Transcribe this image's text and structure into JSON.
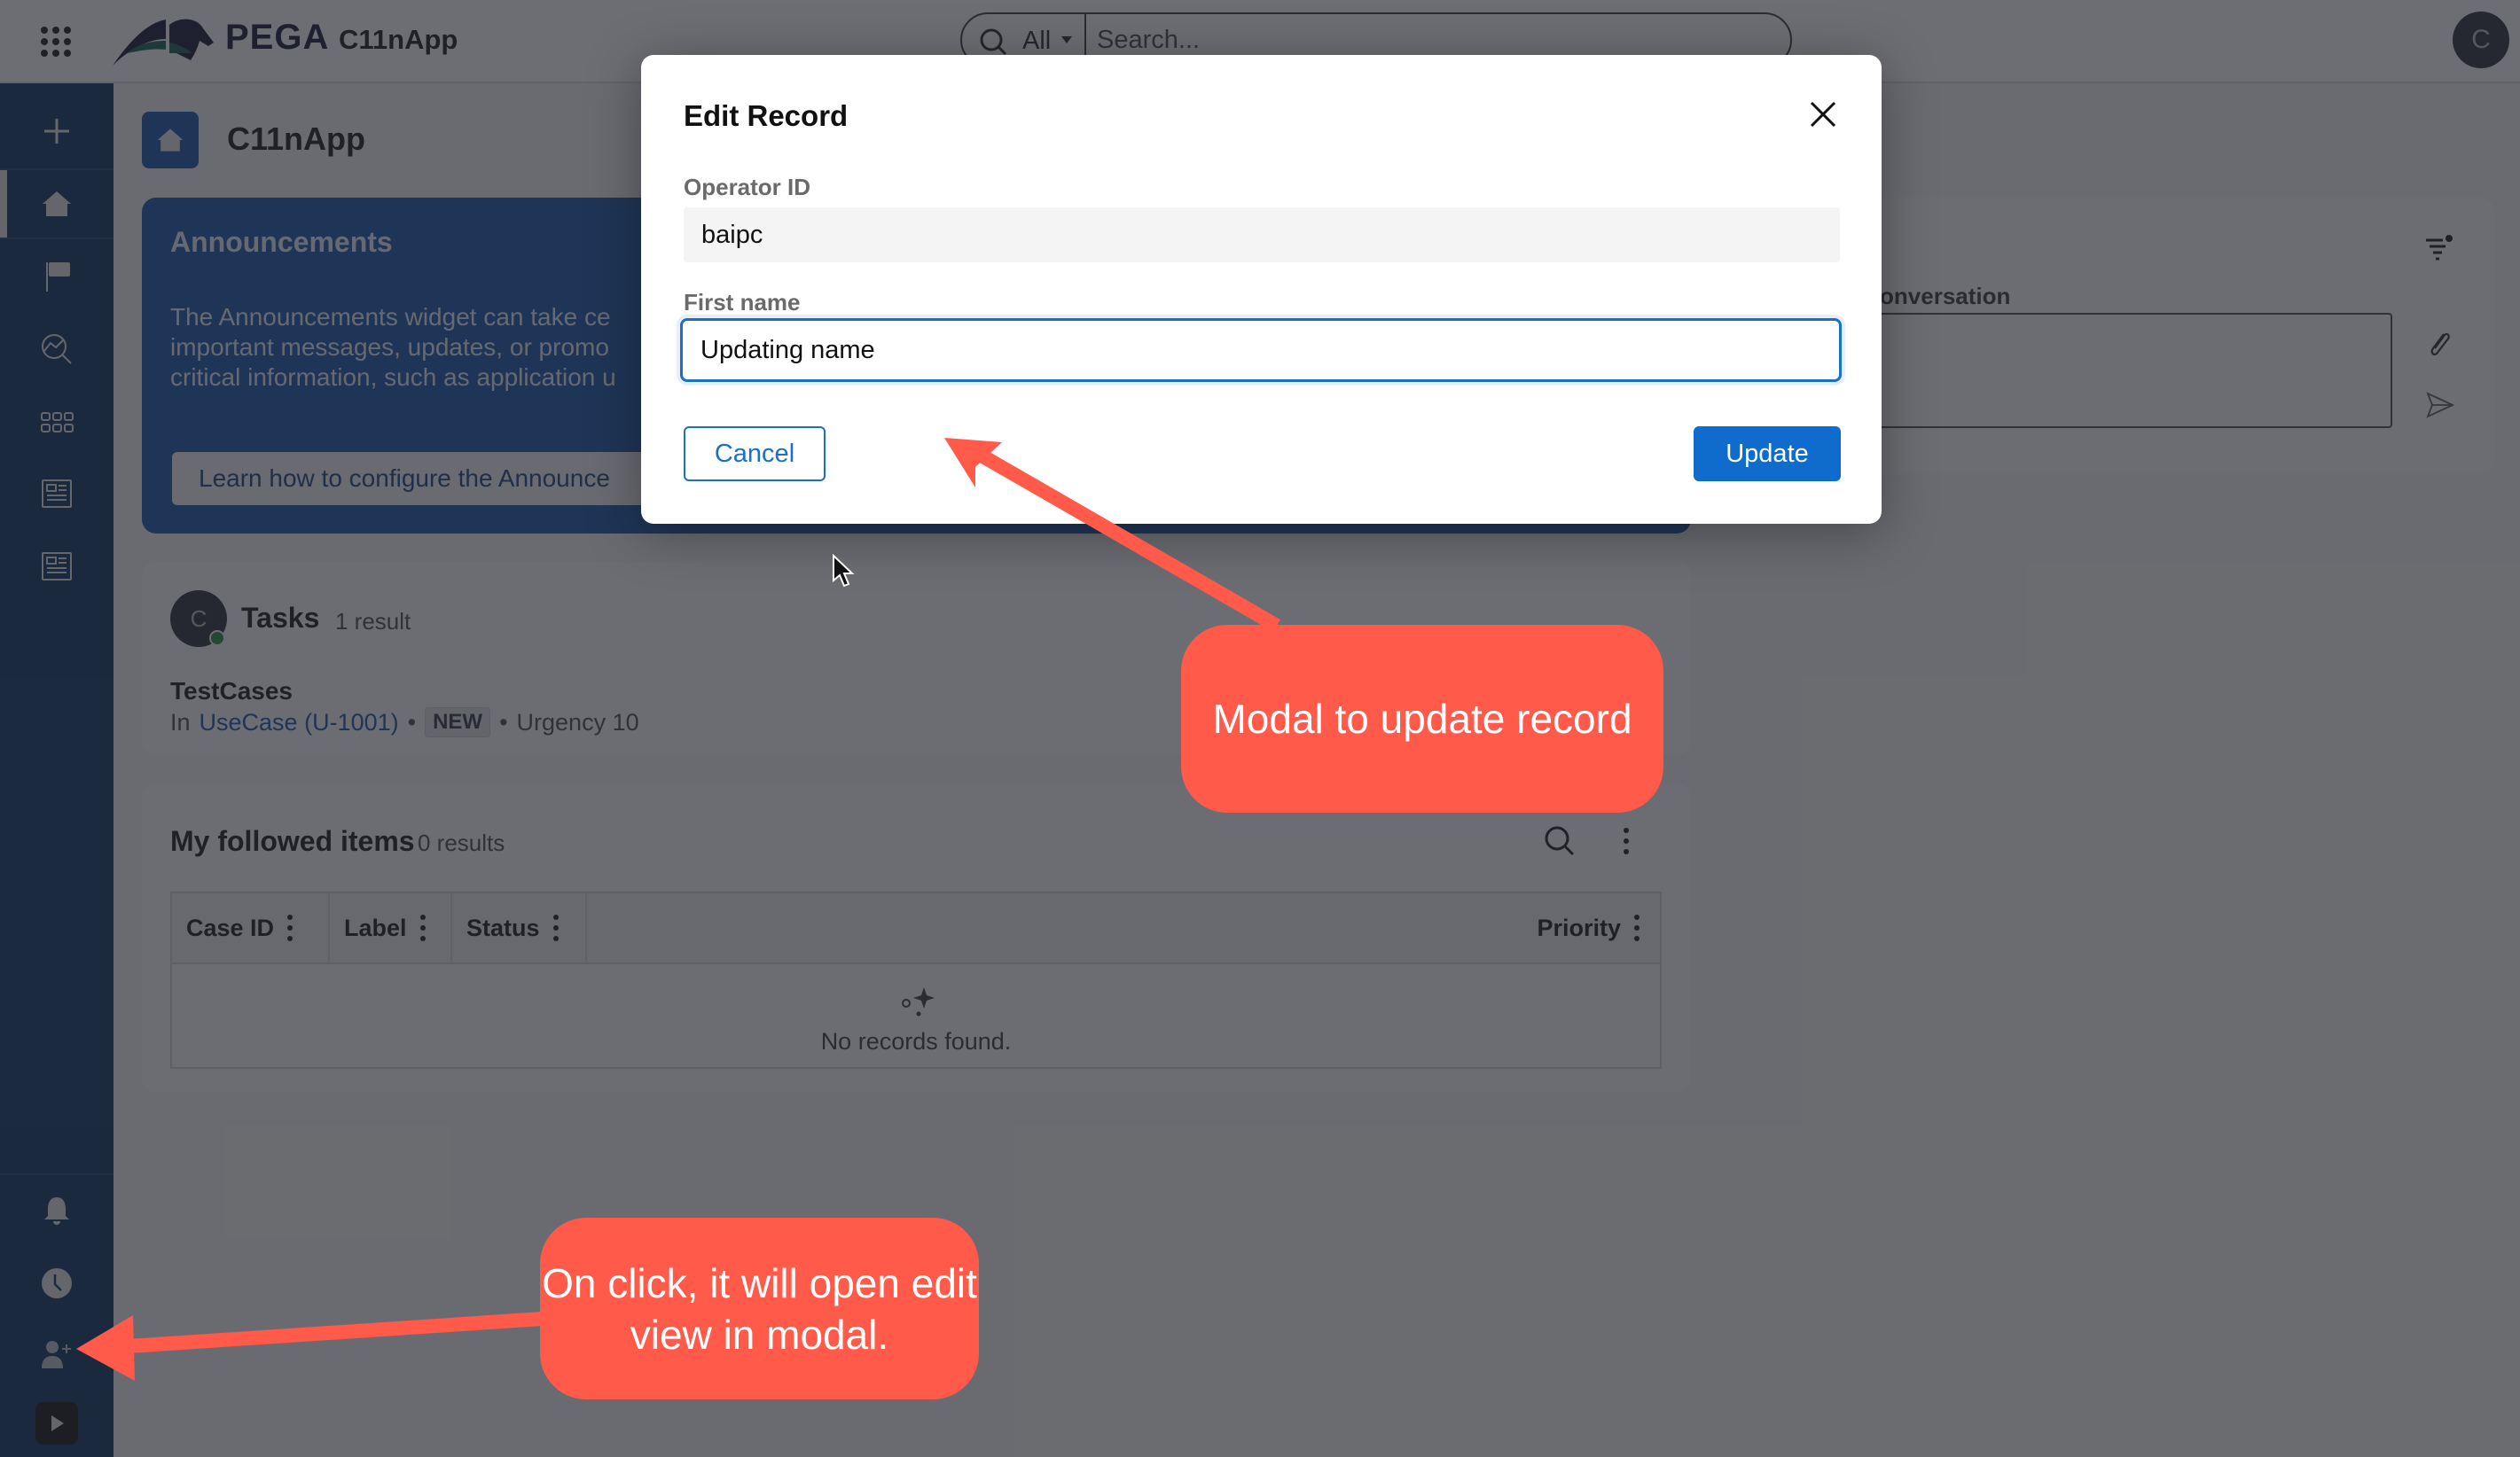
{
  "header": {
    "brand": "PEGA",
    "app_name": "C11nApp",
    "search_scope": "All",
    "search_placeholder": "Search...",
    "user_initial": "C"
  },
  "sidebar": {
    "items": [
      {
        "icon": "plus-icon",
        "label": "Create"
      },
      {
        "icon": "home-icon",
        "label": "Home",
        "active": true
      },
      {
        "icon": "flag-icon",
        "label": "Flag"
      },
      {
        "icon": "analytics-search-icon",
        "label": "Explore data"
      },
      {
        "icon": "grid-icon",
        "label": "Apps"
      },
      {
        "icon": "document-icon",
        "label": "Page 1"
      },
      {
        "icon": "document-icon",
        "label": "Page 2"
      }
    ],
    "bottom_items": [
      {
        "icon": "bell-icon",
        "label": "Notifications"
      },
      {
        "icon": "clock-icon",
        "label": "Recent"
      },
      {
        "icon": "add-user-icon",
        "label": "Edit profile"
      },
      {
        "icon": "expand-icon",
        "label": "Expand"
      }
    ]
  },
  "page": {
    "title": "C11nApp",
    "icon": "home-icon"
  },
  "announcements": {
    "title": "Announcements",
    "body": "The Announcements widget can take ce\nimportant messages, updates, or promo\ncritical information, such as application u",
    "link": "Learn how to configure the Announce"
  },
  "tasks": {
    "avatar_initial": "C",
    "title": "Tasks",
    "count": "1 result",
    "item": {
      "name": "TestCases",
      "prefix": "In",
      "case_link": "UseCase (U-1001)",
      "status": "NEW",
      "urgency": "Urgency 10"
    }
  },
  "followed": {
    "title": "My followed items",
    "count": "0 results",
    "columns": [
      "Case ID",
      "Label",
      "Status",
      "Priority"
    ],
    "empty_text": "No records found."
  },
  "pulse": {
    "label": "t a conversation"
  },
  "modal": {
    "title": "Edit Record",
    "fields": [
      {
        "label": "Operator ID",
        "value": "baipc",
        "readonly": true
      },
      {
        "label": "First name",
        "value": "Updating name",
        "readonly": false
      }
    ],
    "cancel_label": "Cancel",
    "update_label": "Update"
  },
  "annotations": [
    {
      "text": "Modal to update record",
      "color": "#ff5a4a"
    },
    {
      "text": "On click, it will open edit view in modal.",
      "color": "#ff5a4a"
    }
  ],
  "colors": {
    "brand_navy": "#002a5c",
    "primary_blue": "#0f6ccc",
    "announcement_blue": "#0d4ea8",
    "annotation_red": "#ff5a4a"
  }
}
